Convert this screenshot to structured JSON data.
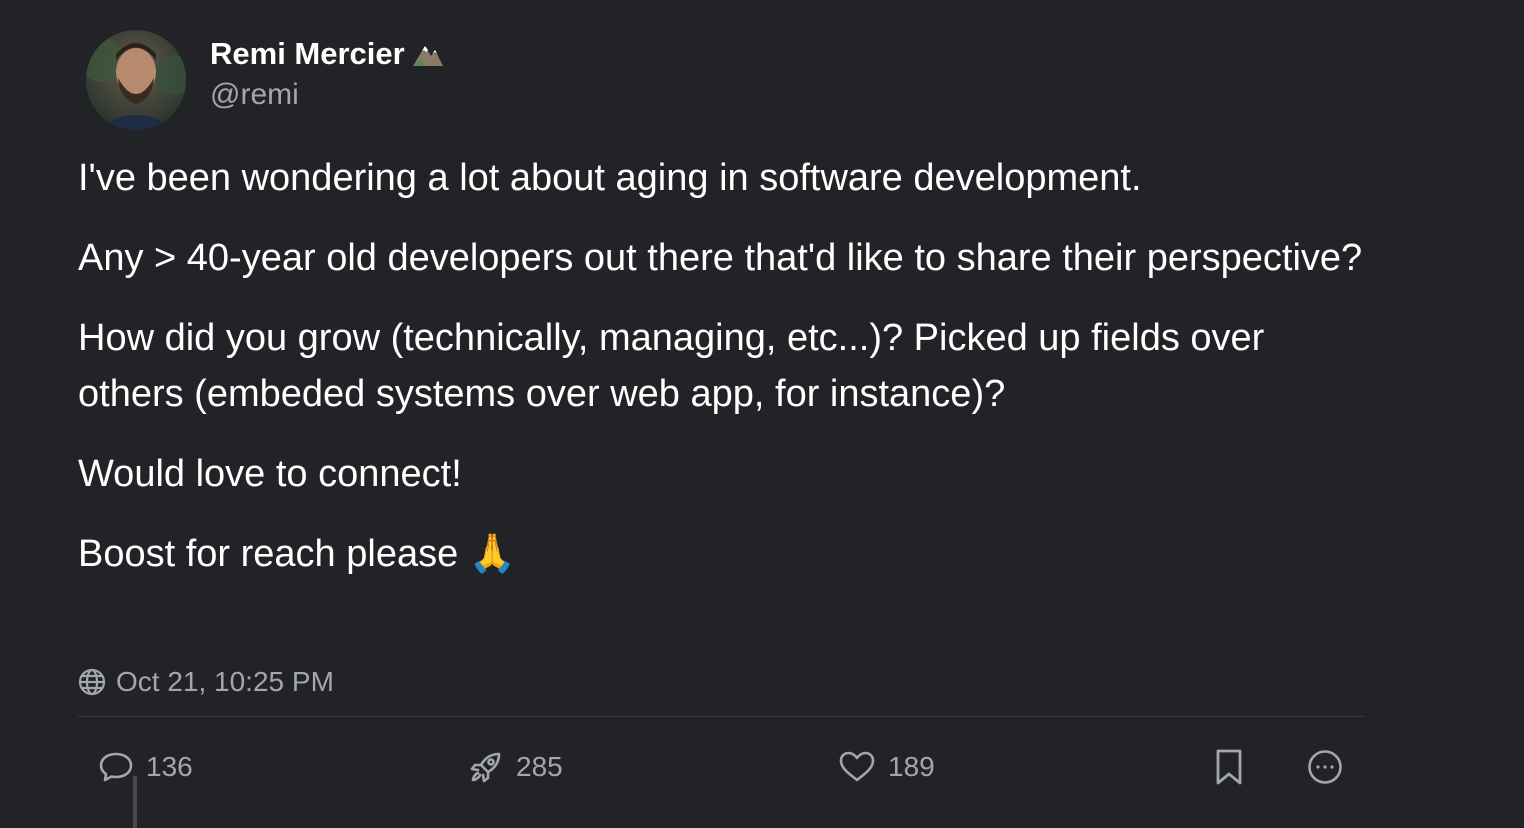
{
  "author": {
    "name": "Remi Mercier",
    "handle": "@remi",
    "name_emoji": "mountain-icon"
  },
  "post": {
    "paragraphs": [
      "I've been wondering a lot about aging in software development.",
      "Any > 40-year old developers out there that'd like to share their perspective?",
      "How did you grow (technically, managing, etc...)? Picked up fields over others (embeded systems over web app, for instance)?",
      "Would love to connect!",
      "Boost for reach please"
    ],
    "trailing_emoji": "🙏",
    "visibility_icon": "globe-icon",
    "timestamp": "Oct 21, 10:25 PM"
  },
  "actions": {
    "replies": "136",
    "boosts": "285",
    "favourites": "189"
  },
  "colors": {
    "background": "#222326",
    "text": "#ffffff",
    "muted": "#a3a6ad",
    "divider": "#3a3b40"
  }
}
